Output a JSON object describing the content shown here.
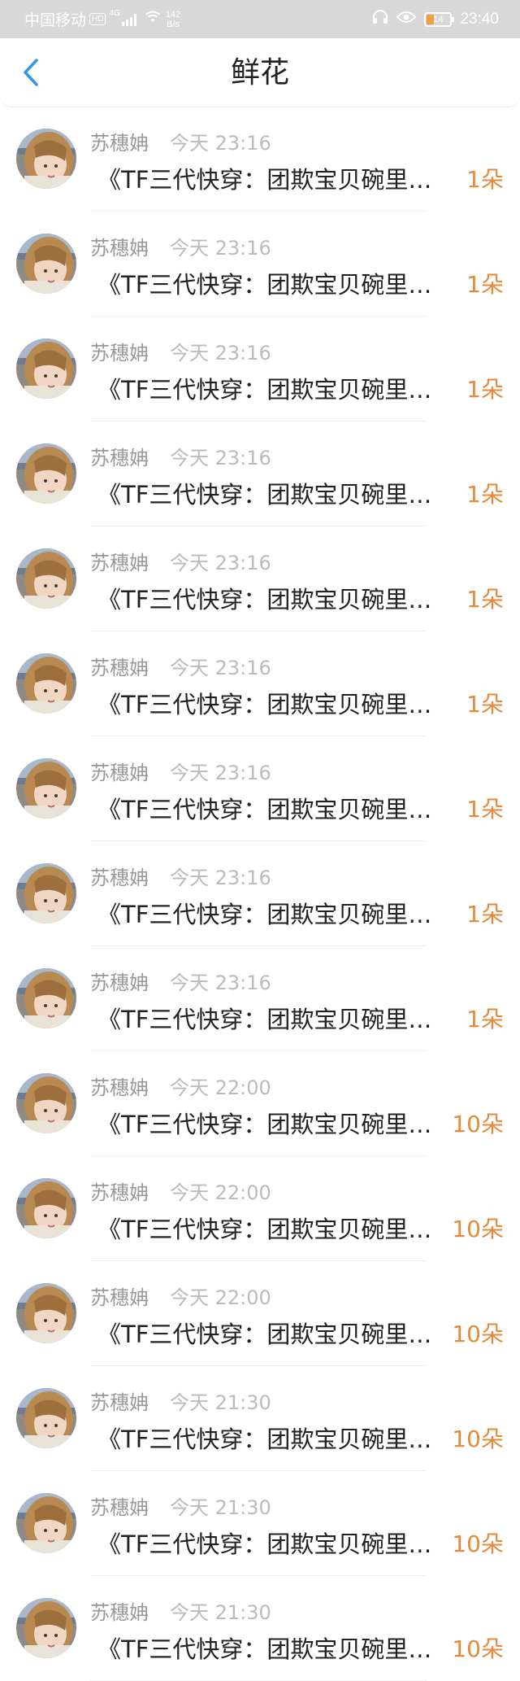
{
  "status_bar": {
    "carrier": "中国移动",
    "hd": "HD",
    "network": "4G",
    "speed_value": "142",
    "speed_unit": "B/s",
    "battery_level": "14",
    "time": "23:40",
    "icons": [
      "signal-icon",
      "wifi-icon",
      "headphones-icon",
      "eye-icon",
      "battery-icon"
    ]
  },
  "nav": {
    "back_icon": "chevron-left-icon",
    "title": "鲜花"
  },
  "colors": {
    "accent_blue": "#2f97f0",
    "count_orange": "#e58a3a",
    "name_gray": "#999999",
    "status_bar_bg": "#d8d8d8"
  },
  "records": [
    {
      "name": "苏穗姌",
      "time": "今天 23:16",
      "book": "《TF三代快穿：团欺宝贝碗里…",
      "count": "1朵"
    },
    {
      "name": "苏穗姌",
      "time": "今天 23:16",
      "book": "《TF三代快穿：团欺宝贝碗里…",
      "count": "1朵"
    },
    {
      "name": "苏穗姌",
      "time": "今天 23:16",
      "book": "《TF三代快穿：团欺宝贝碗里…",
      "count": "1朵"
    },
    {
      "name": "苏穗姌",
      "time": "今天 23:16",
      "book": "《TF三代快穿：团欺宝贝碗里…",
      "count": "1朵"
    },
    {
      "name": "苏穗姌",
      "time": "今天 23:16",
      "book": "《TF三代快穿：团欺宝贝碗里…",
      "count": "1朵"
    },
    {
      "name": "苏穗姌",
      "time": "今天 23:16",
      "book": "《TF三代快穿：团欺宝贝碗里…",
      "count": "1朵"
    },
    {
      "name": "苏穗姌",
      "time": "今天 23:16",
      "book": "《TF三代快穿：团欺宝贝碗里…",
      "count": "1朵"
    },
    {
      "name": "苏穗姌",
      "time": "今天 23:16",
      "book": "《TF三代快穿：团欺宝贝碗里…",
      "count": "1朵"
    },
    {
      "name": "苏穗姌",
      "time": "今天 23:16",
      "book": "《TF三代快穿：团欺宝贝碗里…",
      "count": "1朵"
    },
    {
      "name": "苏穗姌",
      "time": "今天 22:00",
      "book": "《TF三代快穿：团欺宝贝碗里…",
      "count": "10朵"
    },
    {
      "name": "苏穗姌",
      "time": "今天 22:00",
      "book": "《TF三代快穿：团欺宝贝碗里…",
      "count": "10朵"
    },
    {
      "name": "苏穗姌",
      "time": "今天 22:00",
      "book": "《TF三代快穿：团欺宝贝碗里…",
      "count": "10朵"
    },
    {
      "name": "苏穗姌",
      "time": "今天 21:30",
      "book": "《TF三代快穿：团欺宝贝碗里…",
      "count": "10朵"
    },
    {
      "name": "苏穗姌",
      "time": "今天 21:30",
      "book": "《TF三代快穿：团欺宝贝碗里…",
      "count": "10朵"
    },
    {
      "name": "苏穗姌",
      "time": "今天 21:30",
      "book": "《TF三代快穿：团欺宝贝碗里…",
      "count": "10朵"
    }
  ]
}
